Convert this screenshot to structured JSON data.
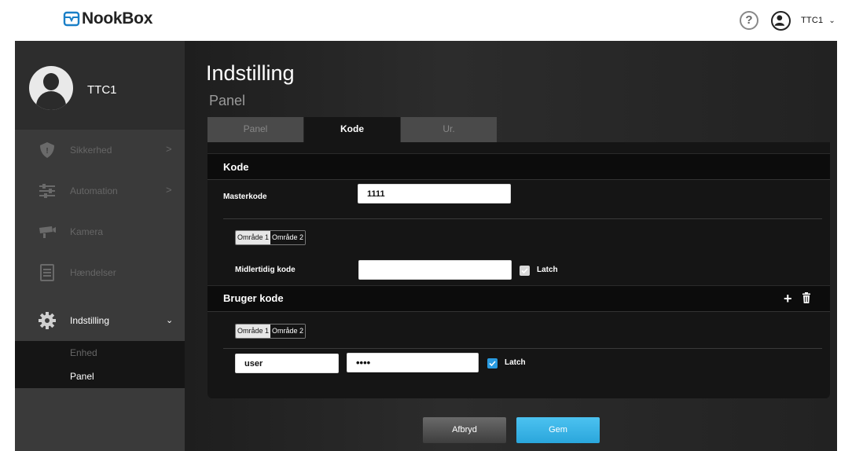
{
  "header": {
    "logo_text": "NookBox",
    "help_symbol": "?",
    "user_label": "TTC1",
    "caret": "⌄"
  },
  "sidebar": {
    "profile_name": "TTC1",
    "items": [
      {
        "label": "Sikkerhed",
        "icon": "shield-icon",
        "arrow": ">"
      },
      {
        "label": "Automation",
        "icon": "sliders-icon",
        "arrow": ">"
      },
      {
        "label": "Kamera",
        "icon": "camera-icon"
      },
      {
        "label": "Hændelser",
        "icon": "list-icon"
      },
      {
        "label": "Indstilling",
        "icon": "gear-icon",
        "arrow": "⌄",
        "active": true
      }
    ],
    "sub_items": [
      {
        "label": "Enhed"
      },
      {
        "label": "Panel",
        "active": true
      }
    ]
  },
  "main": {
    "title": "Indstilling",
    "subtitle": "Panel",
    "tabs": [
      {
        "label": "Panel"
      },
      {
        "label": "Kode",
        "active": true
      },
      {
        "label": "Ur."
      }
    ],
    "kode_section": {
      "title": "Kode",
      "masterkode_label": "Masterkode",
      "masterkode_value": "1111",
      "area_tabs": [
        "Område 1",
        "Område 2"
      ],
      "temp_code_label": "Midlertidig kode",
      "temp_code_value": "",
      "latch_label": "Latch",
      "latch_checked": false
    },
    "user_code_section": {
      "title": "Bruger kode",
      "area_tabs": [
        "Område 1",
        "Område 2"
      ],
      "user_value": "user",
      "password_value": "1234",
      "latch_label": "Latch",
      "latch_checked": true
    },
    "buttons": {
      "cancel": "Afbryd",
      "save": "Gem"
    }
  },
  "colors": {
    "accent": "#2aa6dc",
    "sidebar_bg": "#3a3a3a",
    "card_bg": "#151515"
  }
}
